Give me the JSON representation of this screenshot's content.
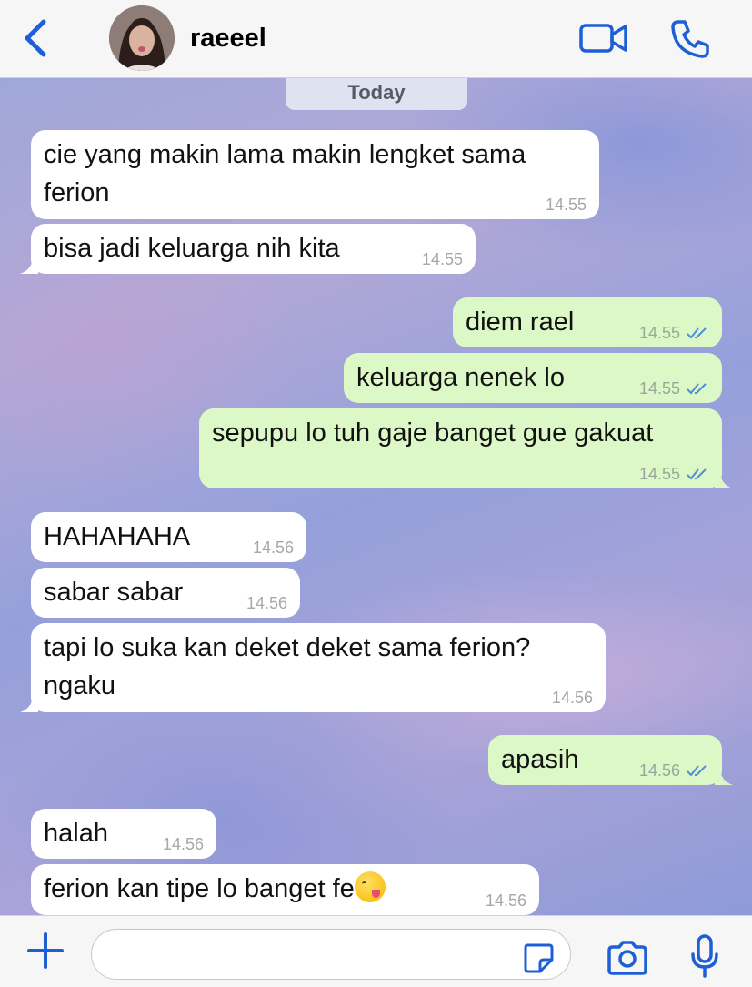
{
  "header": {
    "contact_name": "raeeel",
    "back_icon": "chevron-left-icon",
    "video_icon": "video-camera-icon",
    "call_icon": "phone-icon"
  },
  "chat": {
    "date_label": "Today",
    "messages": [
      {
        "dir": "in",
        "lines": [
          "cie yang makin lama makin lengket sama",
          "ferion"
        ],
        "time": "14.55"
      },
      {
        "dir": "in",
        "lines": [
          "bisa jadi keluarga nih kita"
        ],
        "time": "14.55"
      },
      {
        "dir": "out",
        "lines": [
          "diem rael"
        ],
        "time": "14.55",
        "status": "read"
      },
      {
        "dir": "out",
        "lines": [
          "keluarga nenek lo"
        ],
        "time": "14.55",
        "status": "read"
      },
      {
        "dir": "out",
        "lines": [
          "sepupu lo tuh gaje banget gue gakuat"
        ],
        "time": "14.55",
        "status": "read"
      },
      {
        "dir": "in",
        "lines": [
          "HAHAHAHA"
        ],
        "time": "14.56"
      },
      {
        "dir": "in",
        "lines": [
          "sabar sabar"
        ],
        "time": "14.56"
      },
      {
        "dir": "in",
        "lines": [
          "tapi lo suka kan deket deket sama ferion?",
          "ngaku"
        ],
        "time": "14.56"
      },
      {
        "dir": "out",
        "lines": [
          "apasih"
        ],
        "time": "14.56",
        "status": "read"
      },
      {
        "dir": "in",
        "lines": [
          "halah"
        ],
        "time": "14.56"
      },
      {
        "dir": "in",
        "lines": [
          "ferion kan tipe lo banget fe"
        ],
        "time": "14.56",
        "emoji": "yum-face-emoji"
      }
    ]
  },
  "composer": {
    "input_value": "",
    "plus_icon": "plus-icon",
    "sticker_icon": "sticker-icon",
    "camera_icon": "camera-icon",
    "mic_icon": "microphone-icon"
  },
  "colors": {
    "accent": "#1f5fd6",
    "incoming_bubble": "#ffffff",
    "outgoing_bubble": "#dcf8c6",
    "read_ticks": "#4f8fd8"
  }
}
